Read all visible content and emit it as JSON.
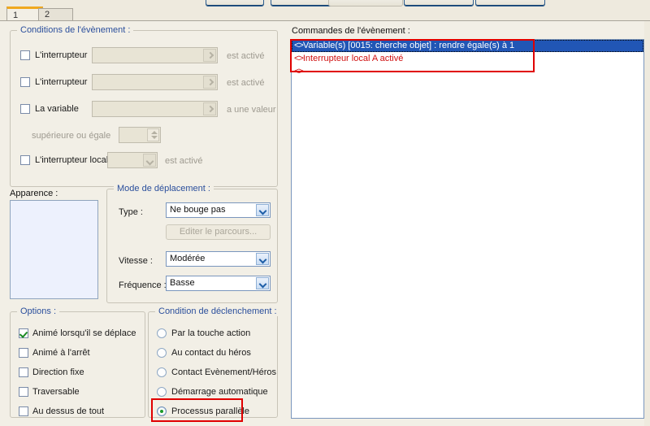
{
  "window": {
    "top_buttons": [
      "",
      "",
      "",
      "",
      ""
    ]
  },
  "tabs": [
    {
      "label": "1",
      "active": true
    },
    {
      "label": "2",
      "active": false
    }
  ],
  "conditions_group": {
    "title": "Conditions de l'évènement :",
    "rows": [
      {
        "checkbox_label": "L'interrupteur",
        "checked": false,
        "field_value": "",
        "suffix": "est activé"
      },
      {
        "checkbox_label": "L'interrupteur",
        "checked": false,
        "field_value": "",
        "suffix": "est activé"
      },
      {
        "checkbox_label": "La variable",
        "checked": false,
        "field_value": "",
        "suffix": "a une valeur"
      }
    ],
    "spinner_label": "supérieure ou égale",
    "spinner_value": "",
    "local_switch": {
      "checkbox_label": "L'interrupteur local",
      "checked": false,
      "value": "",
      "suffix": "est activé"
    }
  },
  "appearance": {
    "title": "Apparence :",
    "preview_color": "#edf1fd"
  },
  "movement_group": {
    "title": "Mode de déplacement :",
    "type_label": "Type :",
    "type_value": "Ne bouge pas",
    "edit_path_button": "Editer le parcours...",
    "speed_label": "Vitesse :",
    "speed_value": "Modérée",
    "frequency_label": "Fréquence :",
    "frequency_value": "Basse"
  },
  "options_group": {
    "title": "Options :",
    "items": [
      {
        "label": "Animé lorsqu'il se déplace",
        "checked": true
      },
      {
        "label": "Animé à l'arrêt",
        "checked": false
      },
      {
        "label": "Direction fixe",
        "checked": false
      },
      {
        "label": "Traversable",
        "checked": false
      },
      {
        "label": "Au dessus de tout",
        "checked": false
      }
    ]
  },
  "trigger_group": {
    "title": "Condition de déclenchement :",
    "items": [
      {
        "label": "Par la touche action",
        "selected": false
      },
      {
        "label": "Au contact du héros",
        "selected": false
      },
      {
        "label": "Contact Evènement/Héros",
        "selected": false
      },
      {
        "label": "Démarrage automatique",
        "selected": false
      },
      {
        "label": "Processus parallèle",
        "selected": true
      }
    ],
    "highlight_color": "#e00000"
  },
  "commands_panel": {
    "title": "Commandes de l'évènement :",
    "rows": [
      {
        "marker": "<>",
        "text": "Variable(s) [0015: cherche objet] : rendre égale(s) à 1",
        "selected": true
      },
      {
        "marker": "<>",
        "text": "Interrupteur local A activé",
        "selected": false
      },
      {
        "marker": "<>",
        "text": "",
        "selected": false
      }
    ],
    "selection_color": "#2156b5",
    "text_color": "#d01010",
    "highlight_color": "#e00000"
  }
}
